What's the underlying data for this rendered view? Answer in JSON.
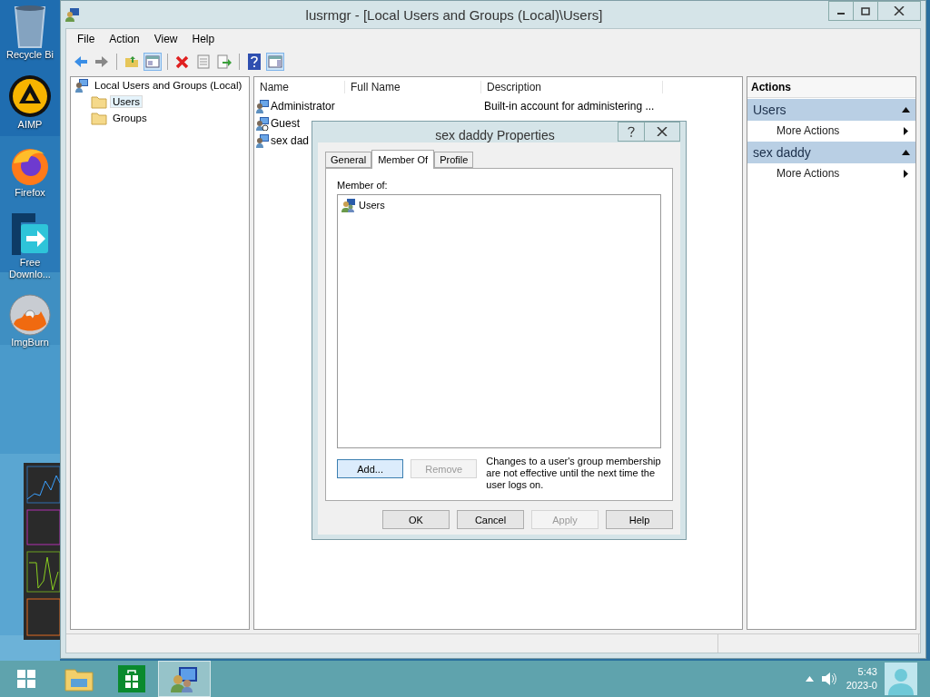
{
  "desktop_icons": [
    {
      "kind": "recycle",
      "label": "Recycle Bi"
    },
    {
      "kind": "aimp",
      "label": "AIMP"
    },
    {
      "kind": "firefox",
      "label": "Firefox"
    },
    {
      "kind": "download",
      "label": "Free Downlo..."
    },
    {
      "kind": "disc",
      "label": "ImgBurn"
    }
  ],
  "window": {
    "title": "lusrmgr - [Local Users and Groups (Local)\\Users]"
  },
  "menu": [
    "File",
    "Action",
    "View",
    "Help"
  ],
  "toolbar": [
    {
      "kind": "back",
      "on": false
    },
    {
      "kind": "forward",
      "on": false
    },
    {
      "kind": "sep"
    },
    {
      "kind": "up",
      "on": false
    },
    {
      "kind": "tree",
      "on": true
    },
    {
      "kind": "sep"
    },
    {
      "kind": "delete",
      "on": false
    },
    {
      "kind": "properties",
      "on": false
    },
    {
      "kind": "export",
      "on": false
    },
    {
      "kind": "sep"
    },
    {
      "kind": "help",
      "on": false
    },
    {
      "kind": "pane",
      "on": true
    }
  ],
  "tree": [
    {
      "label": "Local Users and Groups (Local)",
      "selected": false,
      "children": [
        {
          "label": "Users",
          "selected": true
        },
        {
          "label": "Groups",
          "selected": false
        }
      ]
    }
  ],
  "list": {
    "columns": [
      "Name",
      "Full Name",
      "Description"
    ],
    "rows": [
      {
        "kind": "admin",
        "name": "Administrator",
        "description": "Built-in account for administering ..."
      },
      {
        "kind": "guest",
        "name": "Guest"
      },
      {
        "kind": "user",
        "name": "sex dad"
      }
    ]
  },
  "actions": {
    "title": "Actions",
    "sections": [
      {
        "title": "Users",
        "expanded": true,
        "items": [
          "More Actions"
        ]
      },
      {
        "title": "sex daddy",
        "expanded": true,
        "items": [
          "More Actions"
        ]
      }
    ]
  },
  "dialog": {
    "title": "sex daddy Properties",
    "tabs": [
      {
        "label": "General",
        "selected": false
      },
      {
        "label": "Member Of",
        "selected": true
      },
      {
        "label": "Profile",
        "selected": false
      }
    ],
    "list_label": "Member of:",
    "members": [
      "Users"
    ],
    "buttons": [
      {
        "label": "Add...",
        "disabled": false,
        "focused": true
      },
      {
        "label": "Remove",
        "disabled": true,
        "focused": false
      }
    ],
    "note": "Changes to a user's group membership are not effective until the next time the user logs on.",
    "footer_buttons": [
      {
        "label": "OK",
        "disabled": false
      },
      {
        "label": "Cancel",
        "disabled": false
      },
      {
        "label": "Apply",
        "disabled": true
      },
      {
        "label": "Help",
        "disabled": false
      }
    ]
  },
  "taskbar": {
    "apps": [
      {
        "kind": "explorer",
        "active": false
      },
      {
        "kind": "store",
        "active": false
      },
      {
        "kind": "lusrmgr",
        "active": true
      }
    ],
    "time": "5:43",
    "date": "2023-0"
  }
}
